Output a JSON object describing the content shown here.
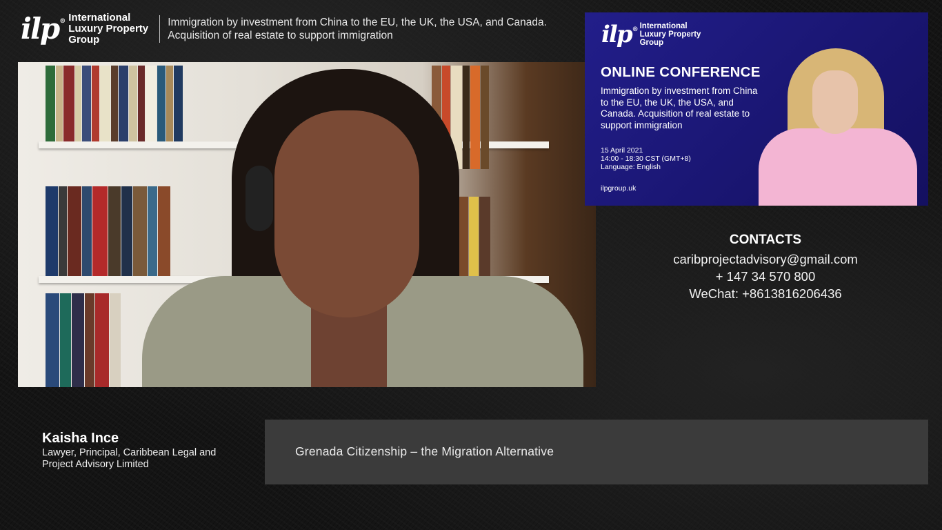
{
  "header": {
    "logo_mark": "ilp",
    "logo_reg": "®",
    "logo_text": "International Luxury Property Group",
    "subtitle": "Immigration by investment from China to the EU, the UK, the USA, and Canada. Acquisition of real estate to support immigration"
  },
  "conference_card": {
    "logo_mark": "ilp",
    "logo_reg": "®",
    "logo_text": "International Luxury Property Group",
    "title": "ONLINE CONFERENCE",
    "description": "Immigration by investment from China to the EU, the UK, the USA, and Canada. Acquisition of real estate to support immigration",
    "date": "15 April 2021",
    "time": "14:00 - 18:30 CST (GMT+8)",
    "language": "Language: English",
    "website": "ilpgroup.uk"
  },
  "contacts": {
    "title": "CONTACTS",
    "email": "caribprojectadvisory@gmail.com",
    "phone": "+ 147 34 570 800",
    "wechat": "WeChat: +8613816206436"
  },
  "speaker": {
    "name": "Kaisha Ince",
    "role": "Lawyer, Principal, Caribbean Legal and Project Advisory Limited"
  },
  "topic": {
    "text": "Grenada Citizenship – the Migration Alternative"
  },
  "colors": {
    "conference_bg": "#1f1b85",
    "topic_bar_bg": "#3b3b3b",
    "page_bg": "#141414"
  }
}
